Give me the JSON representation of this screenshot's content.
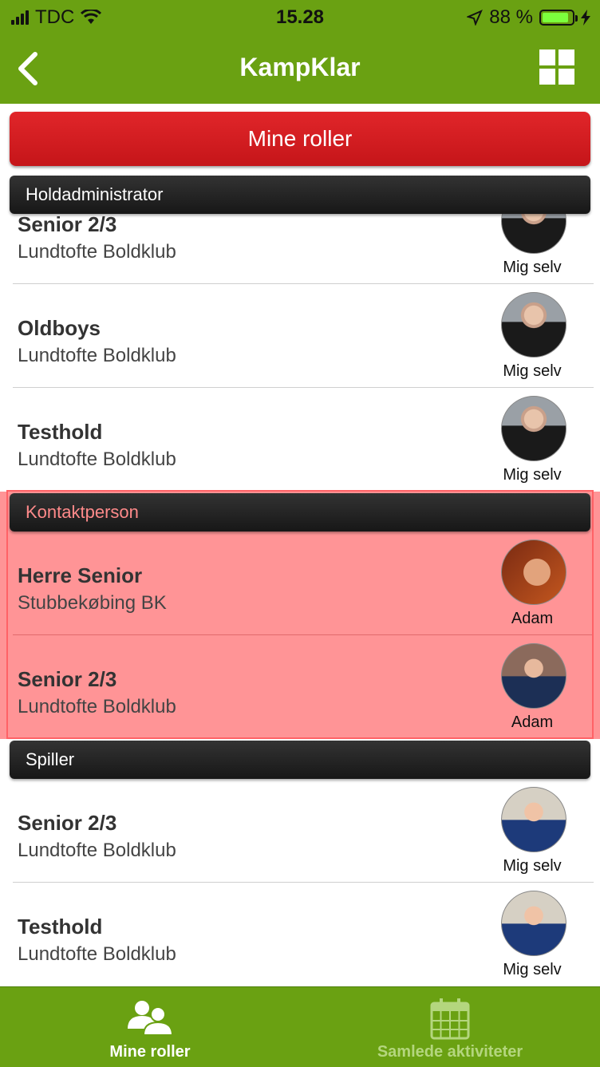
{
  "status_bar": {
    "carrier": "TDC",
    "time": "15.28",
    "battery": "88 %",
    "battery_level": 0.88
  },
  "nav": {
    "title": "KampKlar"
  },
  "roles_button": {
    "label": "Mine roller"
  },
  "sections": [
    {
      "title": "Holdadministrator",
      "rows": [
        {
          "team": "Senior 2/3",
          "club": "Lundtofte Boldklub",
          "person": "Mig selv"
        },
        {
          "team": "Oldboys",
          "club": "Lundtofte Boldklub",
          "person": "Mig selv"
        },
        {
          "team": "Testhold",
          "club": "Lundtofte Boldklub",
          "person": "Mig selv"
        }
      ]
    },
    {
      "title": "Kontaktperson",
      "rows": [
        {
          "team": "Herre Senior",
          "club": "Stubbekøbing BK",
          "person": "Adam"
        },
        {
          "team": "Senior 2/3",
          "club": "Lundtofte Boldklub",
          "person": "Adam"
        }
      ]
    },
    {
      "title": "Spiller",
      "rows": [
        {
          "team": "Senior 2/3",
          "club": "Lundtofte Boldklub",
          "person": "Mig selv"
        },
        {
          "team": "Testhold",
          "club": "Lundtofte Boldklub",
          "person": "Mig selv"
        }
      ]
    }
  ],
  "tabbar": {
    "tabs": [
      {
        "label": "Mine roller",
        "icon": "users-icon",
        "active": true
      },
      {
        "label": "Samlede aktiviteter",
        "icon": "calendar-icon",
        "active": false
      }
    ]
  },
  "colors": {
    "brand_green": "#6aa112",
    "roles_red": "#d51c20",
    "contact_highlight": "#ff9496"
  }
}
